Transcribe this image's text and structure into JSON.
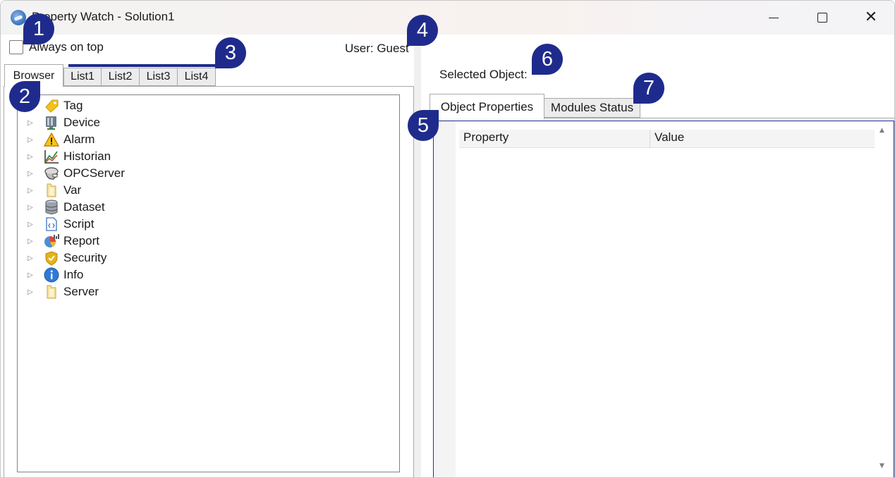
{
  "window": {
    "title": "Property Watch - Solution1",
    "controls": {
      "minimize": "—",
      "maximize": "☐",
      "close": "✕"
    }
  },
  "header": {
    "always_on_top_label": "Always on top",
    "always_on_top_checked": false,
    "user_label": "User: Guest"
  },
  "left_tabs": [
    "Browser",
    "List1",
    "List2",
    "List3",
    "List4"
  ],
  "tree": {
    "expander_glyph": "▷",
    "items": [
      {
        "label": "Tag",
        "icon": "tag-icon"
      },
      {
        "label": "Device",
        "icon": "device-icon"
      },
      {
        "label": "Alarm",
        "icon": "alarm-icon"
      },
      {
        "label": "Historian",
        "icon": "historian-icon"
      },
      {
        "label": "OPCServer",
        "icon": "opcserver-icon"
      },
      {
        "label": "Var",
        "icon": "var-icon"
      },
      {
        "label": "Dataset",
        "icon": "dataset-icon"
      },
      {
        "label": "Script",
        "icon": "script-icon"
      },
      {
        "label": "Report",
        "icon": "report-icon"
      },
      {
        "label": "Security",
        "icon": "security-icon"
      },
      {
        "label": "Info",
        "icon": "info-icon"
      },
      {
        "label": "Server",
        "icon": "server-icon"
      }
    ]
  },
  "right": {
    "selected_object_label": "Selected Object:",
    "tabs": [
      "Object Properties",
      "Modules Status"
    ],
    "grid_headers": {
      "property": "Property",
      "value": "Value"
    }
  },
  "callouts": [
    "1",
    "2",
    "3",
    "4",
    "5",
    "6",
    "7"
  ],
  "colors": {
    "callout": "#1f2b8c",
    "panel_border": "#1f2b8c"
  }
}
